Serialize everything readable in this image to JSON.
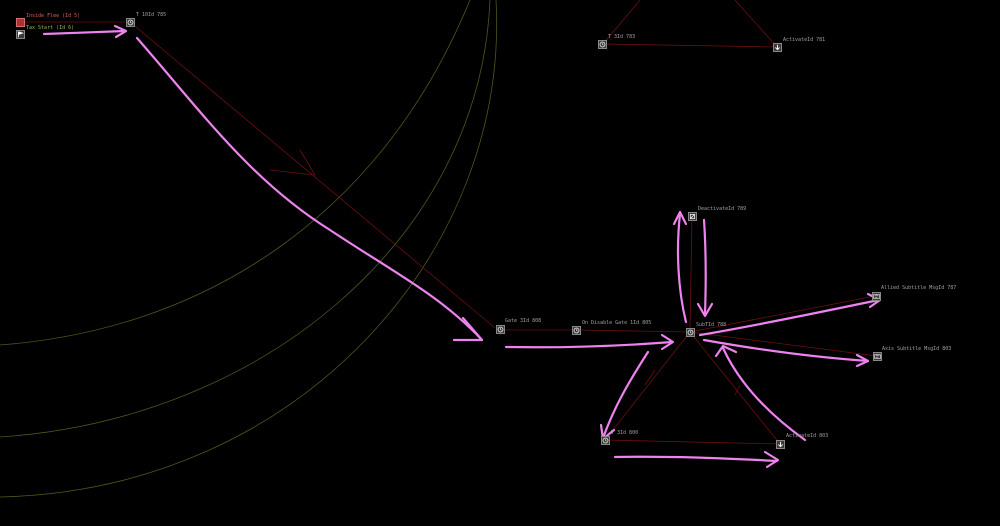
{
  "colors": {
    "background": "#000000",
    "annotation_arrow": "#ee82ee",
    "curve_line": "#4a5a1c",
    "edge_line": "#6b1010",
    "node_fill": "#3a3a3a"
  },
  "nodes": [
    {
      "id": "inside-flee",
      "label": "Inside Flee (Id 5)",
      "icon": "red-square-icon"
    },
    {
      "id": "tax-start",
      "label": "Tax Start (Id 6)",
      "icon": "flag-icon"
    },
    {
      "id": "t-10",
      "label": "T 10Id 785",
      "icon": "clock-icon"
    },
    {
      "id": "t-3",
      "label": "T 3Id 783",
      "icon": "clock-icon"
    },
    {
      "id": "activate-top",
      "label": "ActivateId 781",
      "icon": "down-arrow-icon"
    },
    {
      "id": "deactivate",
      "label": "DeactivateId 789",
      "icon": "deactivate-icon"
    },
    {
      "id": "gate",
      "label": "Gate 3Id 808",
      "icon": "clock-icon"
    },
    {
      "id": "on-disable-gate",
      "label": "On Disable Gate 1Id 805",
      "icon": "clock-icon"
    },
    {
      "id": "subt",
      "label": "SubTId 788",
      "icon": "clock-icon"
    },
    {
      "id": "allied-subtitle",
      "label": "Allied Subtitle MsgId 787",
      "icon": "message-icon"
    },
    {
      "id": "axis-subtitle",
      "label": "Axis Subtitle MsgId 803",
      "icon": "message-icon"
    },
    {
      "id": "t-bottom",
      "label": "T 3Id 800",
      "icon": "clock-icon"
    },
    {
      "id": "activate-bottom",
      "label": "ActivateId 803",
      "icon": "down-arrow-icon"
    }
  ]
}
